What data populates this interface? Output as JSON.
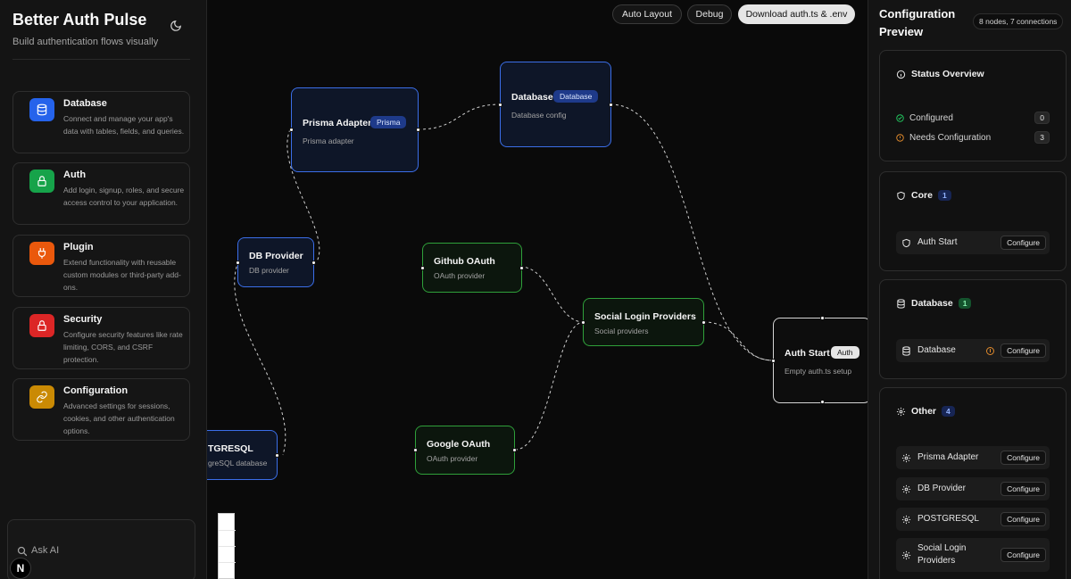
{
  "brand": {
    "title": "Better Auth Pulse",
    "subtitle": "Build authentication flows visually",
    "theme_icon": "moon-icon"
  },
  "categories": [
    {
      "title": "Database",
      "desc": "Connect and manage your app's data with tables, fields, and queries.",
      "color": "#2563eb",
      "icon": "database-icon"
    },
    {
      "title": "Auth",
      "desc": "Add login, signup, roles, and secure access control to your application.",
      "color": "#16a34a",
      "icon": "lock-icon"
    },
    {
      "title": "Plugin",
      "desc": "Extend functionality with reusable custom modules or third-party add-ons.",
      "color": "#ea580c",
      "icon": "plug-icon"
    },
    {
      "title": "Security",
      "desc": "Configure security features like rate limiting, CORS, and CSRF protection.",
      "color": "#dc2626",
      "icon": "lock-icon"
    },
    {
      "title": "Configuration",
      "desc": "Advanced settings for sessions, cookies, and other authentication options.",
      "color": "#ca8a04",
      "icon": "link-icon"
    }
  ],
  "ask": {
    "placeholder": "Ask AI"
  },
  "n_badge": "N",
  "toolbar": {
    "auto_layout": "Auto Layout",
    "debug": "Debug",
    "download": "Download auth.ts & .env"
  },
  "nodes": {
    "prisma": {
      "title": "Prisma Adapter",
      "tag": "Prisma",
      "sub": "Prisma adapter"
    },
    "database": {
      "title": "Database",
      "tag": "Database",
      "sub": "Database config"
    },
    "db_provider": {
      "title": "DB Provider",
      "sub": "DB provider"
    },
    "postgres": {
      "title": "TGRESQL",
      "sub": "greSQL database"
    },
    "github": {
      "title": "Github OAuth",
      "sub": "OAuth provider"
    },
    "social": {
      "title": "Social Login Providers",
      "sub": "Social providers"
    },
    "google": {
      "title": "Google OAuth",
      "sub": "OAuth provider"
    },
    "auth_start": {
      "title": "Auth Start",
      "tag": "Auth",
      "sub": "Empty auth.ts setup"
    }
  },
  "panel": {
    "title": "Configuration Preview",
    "count": "8 nodes, 7 connections",
    "status": {
      "title": "Status Overview",
      "configured_label": "Configured",
      "configured_count": "0",
      "needs_label": "Needs Configuration",
      "needs_count": "3",
      "colors": {
        "ok": "#22c55e",
        "warn": "#e08a2c"
      }
    },
    "core": {
      "title": "Core",
      "count": "1",
      "items": [
        {
          "label": "Auth Start",
          "action": "Configure"
        }
      ]
    },
    "database": {
      "title": "Database",
      "count": "1",
      "items": [
        {
          "label": "Database",
          "action": "Configure"
        }
      ]
    },
    "other": {
      "title": "Other",
      "count": "4",
      "items": [
        {
          "label": "Prisma Adapter",
          "action": "Configure"
        },
        {
          "label": "DB Provider",
          "action": "Configure"
        },
        {
          "label": "POSTGRESQL",
          "action": "Configure"
        },
        {
          "label": "Social Login Providers",
          "action": "Configure"
        }
      ]
    }
  }
}
